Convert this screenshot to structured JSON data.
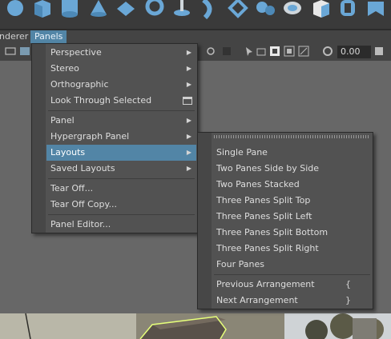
{
  "menubar": {
    "renderer_label": "nderer",
    "panels_label": "Panels"
  },
  "toolbar": {
    "exposure_value": "0.00"
  },
  "panels_menu": {
    "items": [
      {
        "label": "Perspective",
        "submenu": true
      },
      {
        "label": "Stereo",
        "submenu": true
      },
      {
        "label": "Orthographic",
        "submenu": true
      },
      {
        "label": "Look Through Selected",
        "option_box": true
      },
      {
        "label": "Panel",
        "submenu": true
      },
      {
        "label": "Hypergraph Panel",
        "submenu": true
      },
      {
        "label": "Layouts",
        "submenu": true,
        "highlighted": true
      },
      {
        "label": "Saved Layouts",
        "submenu": true
      },
      {
        "label": "Tear Off..."
      },
      {
        "label": "Tear Off Copy..."
      },
      {
        "label": "Panel Editor..."
      }
    ]
  },
  "layouts_menu": {
    "items": [
      {
        "label": "Single Pane"
      },
      {
        "label": "Two Panes Side by Side"
      },
      {
        "label": "Two Panes Stacked"
      },
      {
        "label": "Three Panes Split Top"
      },
      {
        "label": "Three Panes Split Left"
      },
      {
        "label": "Three Panes Split Bottom"
      },
      {
        "label": "Three Panes Split Right"
      },
      {
        "label": "Four Panes"
      },
      {
        "label": "Previous Arrangement",
        "shortcut": "{"
      },
      {
        "label": "Next Arrangement",
        "shortcut": "}"
      }
    ]
  },
  "colors": {
    "highlight": "#5285a6",
    "menu_bg": "#525252",
    "shelf_icon": "#6aa7d6"
  }
}
